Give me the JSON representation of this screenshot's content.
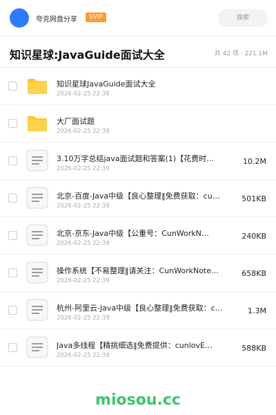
{
  "header": {
    "username": "夸克网盘分享",
    "badge": "SVIP",
    "search_placeholder": "搜索",
    "avatar_color": "#2f7bff"
  },
  "title_bar": {
    "title": "知识星球:JavaGuide面试大全",
    "meta": "共 42 项 · 221.1M"
  },
  "files": [
    {
      "type": "folder",
      "icon": "folder-icon",
      "name": "知识星球JavaGuide面试大全",
      "date": "2026-02-25 22:38",
      "size": ""
    },
    {
      "type": "folder",
      "icon": "folder-icon",
      "name": "大厂面试题",
      "date": "2026-02-25 22:39",
      "size": ""
    },
    {
      "type": "file",
      "icon": "document-icon",
      "name": "3.10万字总结java面试题和答案(1)【花费时…",
      "date": "2026-02-25 22:39",
      "size": "10.2M"
    },
    {
      "type": "file",
      "icon": "document-icon",
      "name": "北京-百度-Java中级【良心整理‖免费获取：cu…",
      "date": "2026-02-25 22:39",
      "size": "501KB"
    },
    {
      "type": "file",
      "icon": "document-icon",
      "name": "北京-京东-Java中级【公重号：CunWorkN…",
      "date": "2026-02-25 22:39",
      "size": "240KB"
    },
    {
      "type": "file",
      "icon": "document-icon",
      "name": "操作系统【不易整理‖请关注：CunWorkNote…",
      "date": "2026-02-25 22:39",
      "size": "658KB"
    },
    {
      "type": "file",
      "icon": "document-icon",
      "name": "杭州-阿里云-Java中级【良心整理‖免费获取：c…",
      "date": "2026-02-25 22:39",
      "size": "1.3M"
    },
    {
      "type": "file",
      "icon": "document-icon",
      "name": "Java多线程【精挑细选‖免费提供：cunlovE…",
      "date": "2026-02-25 22:39",
      "size": "588KB"
    }
  ],
  "watermark": "miosou.cc",
  "colors": {
    "accent": "#2f7bff",
    "svip": "#ff9b2e",
    "folder": "#ffc72e",
    "watermark": "#3ec46d"
  }
}
